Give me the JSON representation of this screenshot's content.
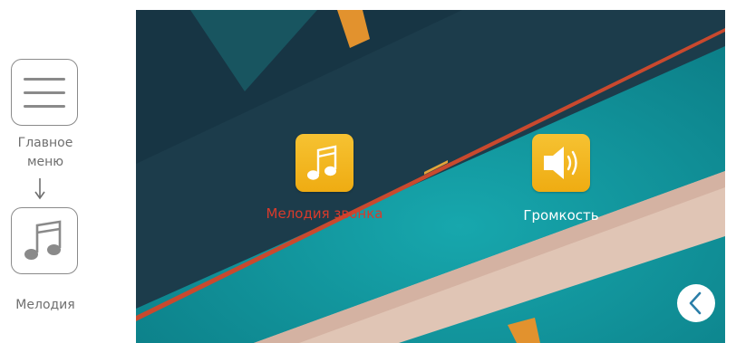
{
  "instructions": {
    "step1_label": "Главное\nменю",
    "step2_label": "Мелодия"
  },
  "screen": {
    "items": [
      {
        "label": "Мелодия звонка",
        "icon": "music-note-icon",
        "selected": true
      },
      {
        "label": "Громкость",
        "icon": "speaker-icon",
        "selected": false
      }
    ],
    "back_icon": "chevron-left-icon"
  },
  "colors": {
    "selected_text": "#d93a2b",
    "tile": "#f2b320",
    "screen_teal": "#0f8e96",
    "screen_dark": "#1d3b4a"
  }
}
